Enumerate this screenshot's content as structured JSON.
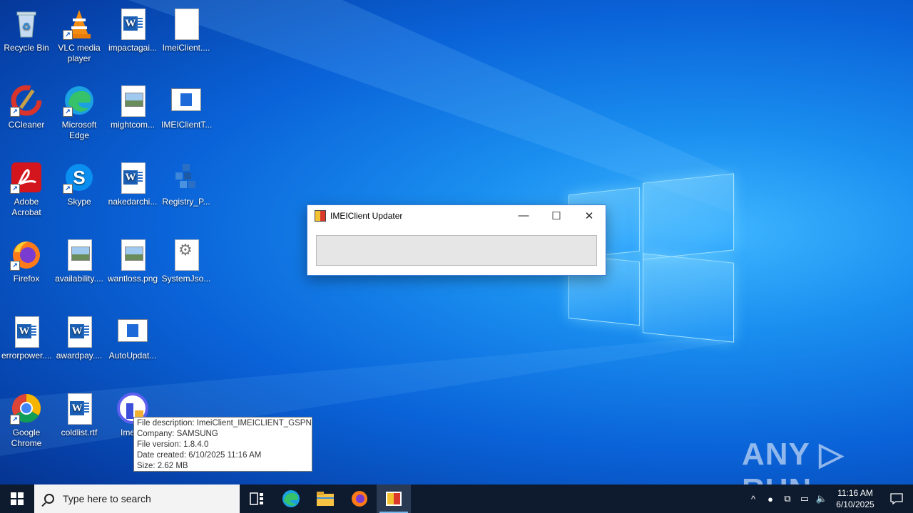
{
  "desktop": {
    "icons": [
      {
        "label": "Recycle Bin",
        "icon": "recycle-bin-icon"
      },
      {
        "label": "VLC media player",
        "icon": "vlc-icon"
      },
      {
        "label": "impactagai...",
        "icon": "word-doc-icon"
      },
      {
        "label": "ImeiClient....",
        "icon": "blank-file-icon"
      },
      {
        "label": "CCleaner",
        "icon": "ccleaner-icon"
      },
      {
        "label": "Microsoft Edge",
        "icon": "edge-icon"
      },
      {
        "label": "mightcom...",
        "icon": "image-file-icon"
      },
      {
        "label": "IMEIClientT...",
        "icon": "app-window-icon"
      },
      {
        "label": "Adobe Acrobat",
        "icon": "acrobat-icon"
      },
      {
        "label": "Skype",
        "icon": "skype-icon"
      },
      {
        "label": "nakedarchi...",
        "icon": "word-doc-icon"
      },
      {
        "label": "Registry_P...",
        "icon": "registry-icon"
      },
      {
        "label": "Firefox",
        "icon": "firefox-icon"
      },
      {
        "label": "availability....",
        "icon": "image-file-icon"
      },
      {
        "label": "wantloss.png",
        "icon": "image-file-icon"
      },
      {
        "label": "SystemJso...",
        "icon": "settings-file-icon"
      },
      {
        "label": "errorpower....",
        "icon": "word-doc-icon"
      },
      {
        "label": "awardpay....",
        "icon": "word-doc-icon"
      },
      {
        "label": "AutoUpdat...",
        "icon": "app-window-icon"
      },
      {
        "label": "Google Chrome",
        "icon": "chrome-icon"
      },
      {
        "label": "coldlist.rtf",
        "icon": "word-doc-icon"
      },
      {
        "label": "ImeiCl",
        "icon": "imeiclient-icon"
      }
    ]
  },
  "dialog": {
    "title": "IMEIClient Updater",
    "minimize": "—",
    "maximize": "☐",
    "close": "✕",
    "progress": 0
  },
  "tooltip": {
    "lines": [
      "File description: ImeiClient_IMEICLIENT_GSPN",
      "Company: SAMSUNG",
      "File version: 1.8.4.0",
      "Date created: 6/10/2025 11:16 AM",
      "Size: 2.62 MB"
    ]
  },
  "watermark": "ANY ▷ RUN",
  "taskbar": {
    "search_placeholder": "Type here to search",
    "time": "11:16 AM",
    "date": "6/10/2025"
  },
  "colors": {
    "accent": "#0a63d8",
    "taskbar": "#0e1b2e"
  }
}
